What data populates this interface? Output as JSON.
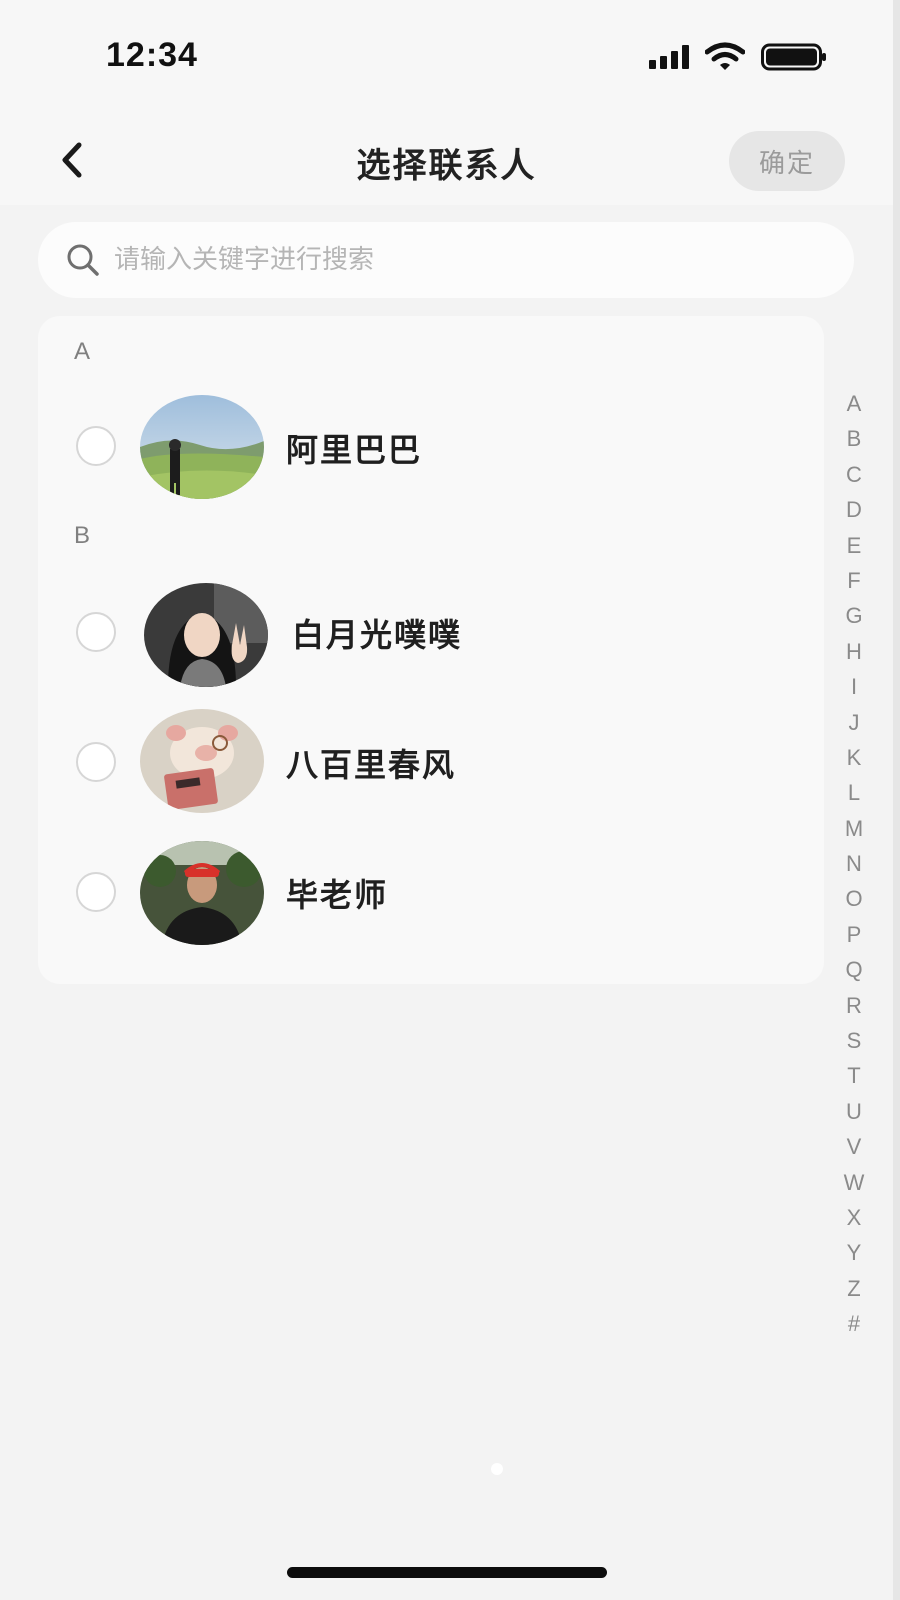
{
  "status_bar": {
    "time": "12:34",
    "icons": [
      "signal-icon",
      "wifi-icon",
      "battery-icon"
    ]
  },
  "header": {
    "back_icon": "chevron-left-icon",
    "title": "选择联系人",
    "confirm_label": "确定"
  },
  "search": {
    "icon": "search-icon",
    "placeholder": "请输入关键字进行搜索",
    "value": ""
  },
  "contact_sections": [
    {
      "letter": "A",
      "contacts": [
        {
          "name": "阿里巴巴",
          "selected": false,
          "avatar": "avatar-photo-landscape-person"
        }
      ]
    },
    {
      "letter": "B",
      "contacts": [
        {
          "name": "白月光噗噗",
          "selected": false,
          "avatar": "avatar-photo-girl-peace-sign"
        },
        {
          "name": "八百里春风",
          "selected": false,
          "avatar": "avatar-photo-pig-plush"
        },
        {
          "name": "毕老师",
          "selected": false,
          "avatar": "avatar-photo-man-red-cap"
        }
      ]
    }
  ],
  "alphabet_index": [
    "A",
    "B",
    "C",
    "D",
    "E",
    "F",
    "G",
    "H",
    "I",
    "J",
    "K",
    "L",
    "M",
    "N",
    "O",
    "P",
    "Q",
    "R",
    "S",
    "T",
    "U",
    "V",
    "W",
    "X",
    "Y",
    "Z",
    "#"
  ],
  "colors": {
    "background": "#f3f3f3",
    "card": "#f9f9f9",
    "confirm_bg": "#e6e6e6",
    "confirm_text": "#9b9b9b",
    "text_primary": "#1f1f1f",
    "text_secondary": "#808080"
  }
}
